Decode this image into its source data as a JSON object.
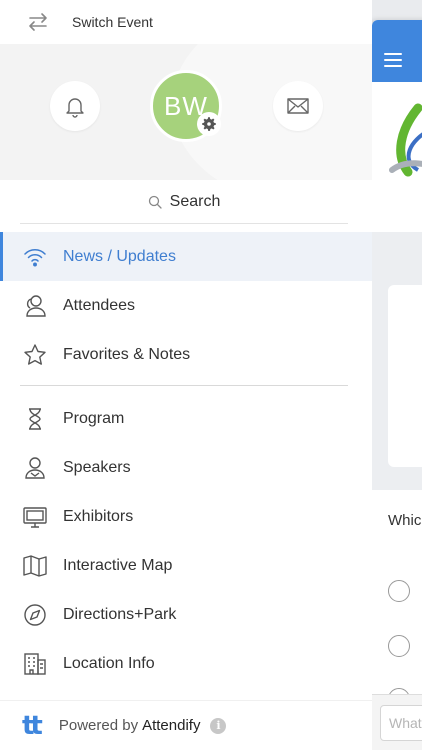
{
  "switch_event": {
    "label": "Switch Event",
    "icon": "swap-arrows-icon"
  },
  "profile": {
    "initials": "BW",
    "avatar_color": "#a6d27c"
  },
  "search": {
    "label": "Search",
    "icon": "search-icon"
  },
  "menu": {
    "primary": [
      {
        "label": "News / Updates",
        "icon": "wifi-icon",
        "active": true
      },
      {
        "label": "Attendees",
        "icon": "users-icon"
      },
      {
        "label": "Favorites & Notes",
        "icon": "star-icon"
      }
    ],
    "secondary": [
      {
        "label": "Program",
        "icon": "hourglass-icon"
      },
      {
        "label": "Speakers",
        "icon": "speaker-icon"
      },
      {
        "label": "Exhibitors",
        "icon": "monitor-icon"
      },
      {
        "label": "Interactive Map",
        "icon": "map-icon"
      },
      {
        "label": "Directions+Park",
        "icon": "compass-icon"
      },
      {
        "label": "Location Info",
        "icon": "building-icon"
      }
    ]
  },
  "footer": {
    "powered_by": "Powered by",
    "brand": "Attendify",
    "logo_text": "tt",
    "info_icon": "i"
  },
  "app": {
    "poll_question": "Whic",
    "input_placeholder": "What"
  },
  "colors": {
    "accent": "#3f86dd",
    "active_text": "#3f7ed0",
    "active_bg": "#eef2f8"
  }
}
